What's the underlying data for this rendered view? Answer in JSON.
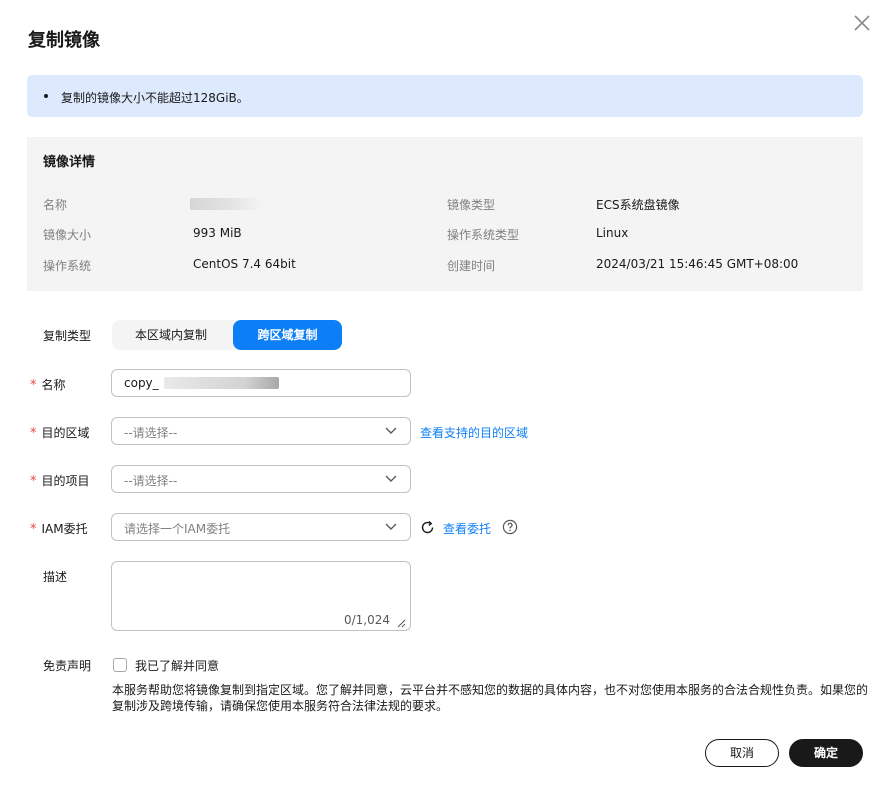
{
  "dialog": {
    "title": "复制镜像"
  },
  "notice": {
    "text": "复制的镜像大小不能超过128GiB。"
  },
  "details": {
    "title": "镜像详情",
    "name_label": "名称",
    "name_value": "",
    "size_label": "镜像大小",
    "size_value": "993 MiB",
    "os_label": "操作系统",
    "os_value": "CentOS 7.4 64bit",
    "type_label": "镜像类型",
    "type_value": "ECS系统盘镜像",
    "os_type_label": "操作系统类型",
    "os_type_value": "Linux",
    "created_label": "创建时间",
    "created_value": "2024/03/21 15:46:45 GMT+08:00"
  },
  "form": {
    "copy_type_label": "复制类型",
    "copy_type_options": [
      "本区域内复制",
      "跨区域复制"
    ],
    "copy_type_selected": "跨区域复制",
    "name_label": "名称",
    "name_value_prefix": "copy_",
    "region_label": "目的区域",
    "region_placeholder": "--请选择--",
    "region_link": "查看支持的目的区域",
    "project_label": "目的项目",
    "project_placeholder": "--请选择--",
    "iam_label": "IAM委托",
    "iam_placeholder": "请选择一个IAM委托",
    "iam_link": "查看委托",
    "description_label": "描述",
    "description_counter": "0/1,024",
    "disclaimer_label": "免责声明",
    "agree_label": "我已了解并同意",
    "disclaimer_text": "本服务帮助您将镜像复制到指定区域。您了解并同意，云平台并不感知您的数据的具体内容，也不对您使用本服务的合法合规性负责。如果您的复制涉及跨境传输，请确保您使用本服务符合法律法规的要求。"
  },
  "footer": {
    "cancel_label": "取消",
    "confirm_label": "确定"
  },
  "colors": {
    "accent": "#0d7ff6",
    "required": "#e84a3f",
    "notice_bg": "#dde9fd",
    "panel_bg": "#f4f4f4",
    "primary_button": "#191919"
  },
  "icons": [
    "close-icon",
    "chevron-down-icon",
    "refresh-icon",
    "help-icon",
    "resize-handle-icon"
  ]
}
